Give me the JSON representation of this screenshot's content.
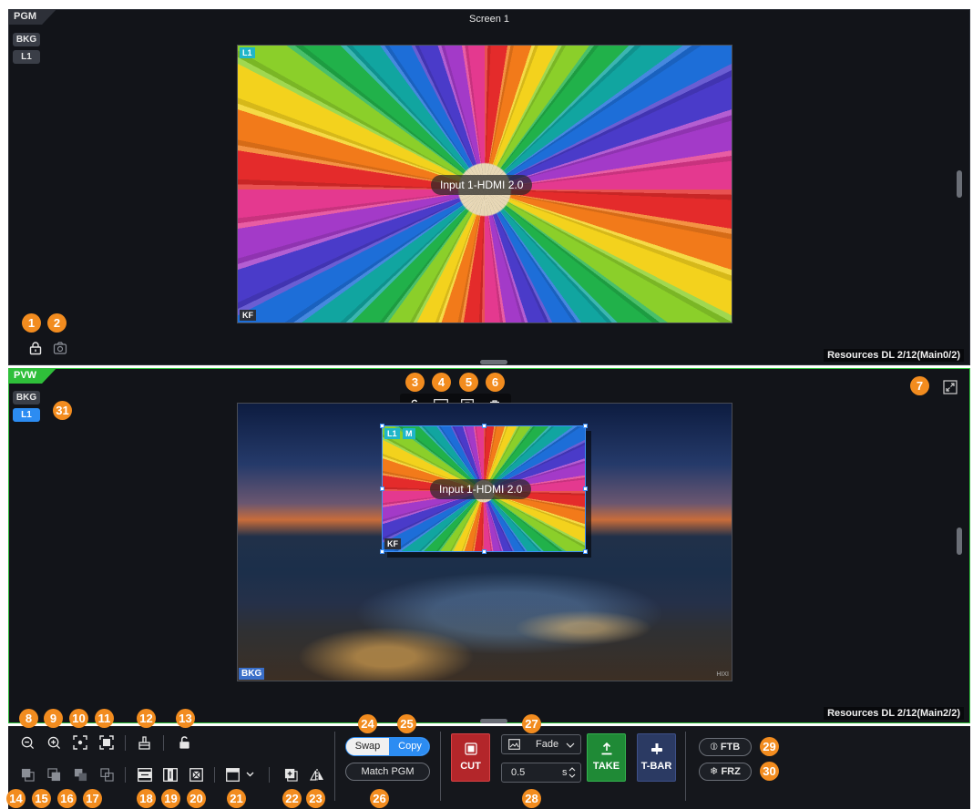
{
  "pgm": {
    "tag": "PGM",
    "screen_title": "Screen 1",
    "layers": [
      "BKG",
      "L1"
    ],
    "canvas_layer_tag": "L1",
    "canvas_kf": "KF",
    "source_label": "Input 1-HDMI 2.0",
    "resources": "Resources DL   2/12(Main0/2)"
  },
  "pvw": {
    "tag": "PVW",
    "layers": [
      "BKG",
      "L1"
    ],
    "window_tags": [
      "L1",
      "M"
    ],
    "window_kf": "KF",
    "source_label": "Input 1-HDMI 2.0",
    "bkg_tag": "BKG",
    "corner_text": "HIXI",
    "resources": "Resources DL   2/12(Main2/2)"
  },
  "controls": {
    "swap": "Swap",
    "copy": "Copy",
    "match_pgm": "Match PGM",
    "cut": "CUT",
    "transition": "Fade",
    "duration": "0.5",
    "duration_unit": "s",
    "take": "TAKE",
    "tbar": "T-BAR",
    "ftb": "FTB",
    "frz": "FRZ"
  },
  "badges": {
    "b1": "1",
    "b2": "2",
    "b3": "3",
    "b4": "4",
    "b5": "5",
    "b6": "6",
    "b7": "7",
    "b8": "8",
    "b9": "9",
    "b10": "10",
    "b11": "11",
    "b12": "12",
    "b13": "13",
    "b14": "14",
    "b15": "15",
    "b16": "16",
    "b17": "17",
    "b18": "18",
    "b19": "19",
    "b20": "20",
    "b21": "21",
    "b22": "22",
    "b23": "23",
    "b24": "24",
    "b25": "25",
    "b26": "26",
    "b27": "27",
    "b28": "28",
    "b29": "29",
    "b30": "30",
    "b31": "31"
  },
  "icons": {
    "zoom_out": "zoom-out-icon",
    "zoom_in": "zoom-in-icon",
    "fit": "fit-icon",
    "fullscreen": "fullscreen-icon",
    "clear": "clear-icon",
    "lock": "lock-icon",
    "snapshot": "camera-icon",
    "delete": "trash-icon"
  },
  "colors": {
    "accent_blue": "#2c8cf2",
    "pvw_green": "#2fbf3a",
    "badge_orange": "#f28c1f",
    "cut_red": "#b3262a",
    "take_green": "#1f8a36",
    "tbar_blue": "#2b3a63"
  }
}
